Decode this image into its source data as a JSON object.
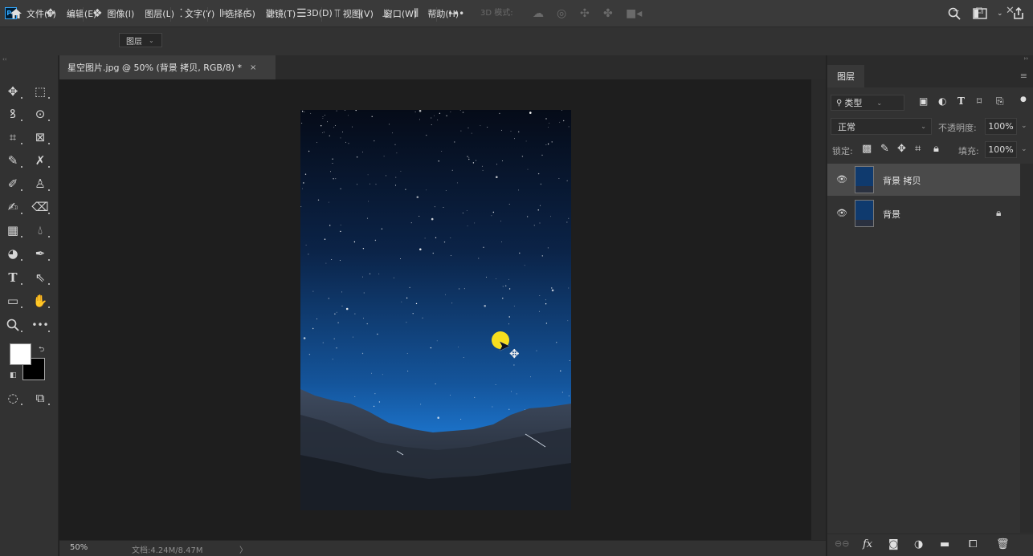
{
  "app": {
    "logo": "Ps",
    "menu": [
      "文件(F)",
      "编辑(E)",
      "图像(I)",
      "图层(L)",
      "文字(Y)",
      "选择(S)",
      "滤镜(T)",
      "3D(D)",
      "视图(V)",
      "窗口(W)",
      "帮助(H)"
    ],
    "window_controls": [
      "minimize-icon",
      "restore-icon",
      "close-icon"
    ]
  },
  "options_bar": {
    "auto_select_value": "图层",
    "mode_3d_label": "3D 模式:",
    "more_label": "•••"
  },
  "document": {
    "tab_title": "星空图片.jpg @ 50% (背景 拷贝, RGB/8) *",
    "close_glyph": "×"
  },
  "status": {
    "zoom": "50%",
    "doc_size": "文档:4.24M/8.47M",
    "arrow": "〉"
  },
  "colors": {
    "foreground": "#ffffff",
    "background": "#000000",
    "cursor_highlight": "#f7df1e"
  },
  "layers_panel": {
    "tab_label": "图层",
    "filter_label": "类型",
    "blend_mode": "正常",
    "opacity_label": "不透明度:",
    "opacity_value": "100%",
    "lock_label": "锁定:",
    "fill_label": "填充:",
    "fill_value": "100%",
    "layers": [
      {
        "name": "背景 拷贝",
        "visible": true,
        "selected": true,
        "locked": false
      },
      {
        "name": "背景",
        "visible": true,
        "selected": false,
        "locked": true
      }
    ]
  }
}
